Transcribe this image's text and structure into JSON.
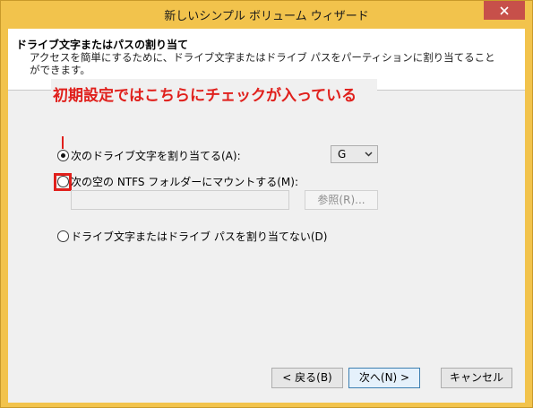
{
  "window": {
    "title": "新しいシンプル ボリューム ウィザード"
  },
  "header": {
    "title": "ドライブ文字またはパスの割り当て",
    "description": "アクセスを簡単にするために、ドライブ文字またはドライブ パスをパーティションに割り当てることができます。"
  },
  "annotation": {
    "text": "初期設定ではこちらにチェックが入っている"
  },
  "options": {
    "assign_letter_label": "次のドライブ文字を割り当てる(A):",
    "drive_letter_value": "G",
    "mount_folder_label": "次の空の NTFS フォルダーにマウントする(M):",
    "browse_label": "参照(R)...",
    "no_assign_label": "ドライブ文字またはドライブ パスを割り当てない(D)"
  },
  "footer": {
    "back_label": "< 戻る(B)",
    "next_label": "次へ(N) >",
    "cancel_label": "キャンセル"
  },
  "colors": {
    "title_bar": "#f2c34c",
    "close_button": "#c7504a",
    "annotation": "#e0201c"
  }
}
